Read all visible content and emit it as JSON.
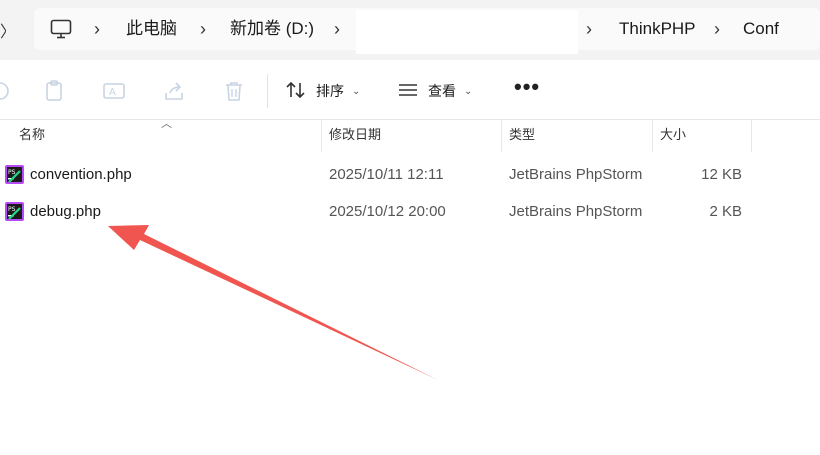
{
  "breadcrumb": {
    "items": [
      "此电脑",
      "新加卷 (D:)",
      "ThinkPHP",
      "Conf"
    ]
  },
  "toolbar": {
    "sort_label": "排序",
    "view_label": "查看",
    "more_label": "•••"
  },
  "columns": {
    "name": "名称",
    "date": "修改日期",
    "type": "类型",
    "size": "大小"
  },
  "files": [
    {
      "name": "convention.php",
      "date": "2025/10/11 12:11",
      "type": "JetBrains PhpStorm",
      "size": "12 KB"
    },
    {
      "name": "debug.php",
      "date": "2025/10/12 20:00",
      "type": "JetBrains PhpStorm",
      "size": "2 KB"
    }
  ],
  "colors": {
    "annotation_arrow": "#f0554f",
    "phpstorm_icon_bg": "#1b1b1b",
    "phpstorm_icon_accent": "#b74af7"
  }
}
